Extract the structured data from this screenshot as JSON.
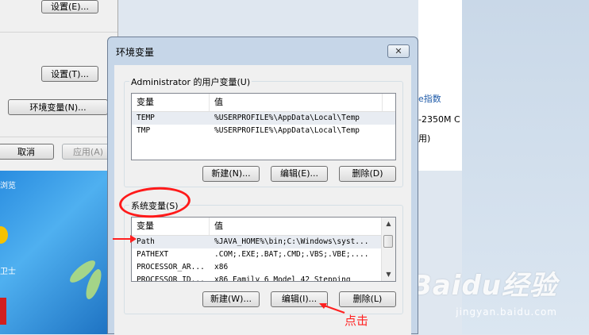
{
  "background": {
    "left_panel": {
      "settings_button_1": "设置(E)...",
      "settings_button_2": "设置(T)...",
      "env_vars_button": "环境变量(N)...",
      "cancel_button": "取消",
      "apply_button": "应用(A)"
    },
    "right_panel": {
      "link_text": "e指数",
      "cpu_text": "-2350M C",
      "line3": "用)"
    },
    "watermark": "Baidu经验",
    "watermark_sub": "jingyan.baidu.com"
  },
  "dialog": {
    "title": "环境变量",
    "close_symbol": "✕",
    "columns": {
      "name": "变量",
      "value": "值"
    },
    "user_vars": {
      "label": "Administrator 的用户变量(U)",
      "rows": [
        {
          "name": "TEMP",
          "value": "%USERPROFILE%\\AppData\\Local\\Temp"
        },
        {
          "name": "TMP",
          "value": "%USERPROFILE%\\AppData\\Local\\Temp"
        }
      ],
      "new_button": "新建(N)...",
      "edit_button": "编辑(E)...",
      "delete_button": "删除(D)"
    },
    "system_vars": {
      "label": "系统变量(S)",
      "rows": [
        {
          "name": "Path",
          "value": "%JAVA_HOME%\\bin;C:\\Windows\\syst..."
        },
        {
          "name": "PATHEXT",
          "value": ".COM;.EXE;.BAT;.CMD;.VBS;.VBE;...."
        },
        {
          "name": "PROCESSOR_AR...",
          "value": "x86"
        },
        {
          "name": "PROCESSOR_ID...",
          "value": "x86 Family 6 Model 42 Stepping"
        }
      ],
      "new_button": "新建(W)...",
      "edit_button": "编辑(I)...",
      "delete_button": "删除(L)"
    }
  },
  "annotation": {
    "click_text": "点击"
  },
  "colors": {
    "annotation_red": "#ff1a1a",
    "dialog_frame": "#c6d6e8",
    "client_bg": "#f0f0f0"
  },
  "icons": {
    "close": "close-icon",
    "scroll_up": "scroll-up-icon",
    "scroll_down": "scroll-down-icon"
  }
}
